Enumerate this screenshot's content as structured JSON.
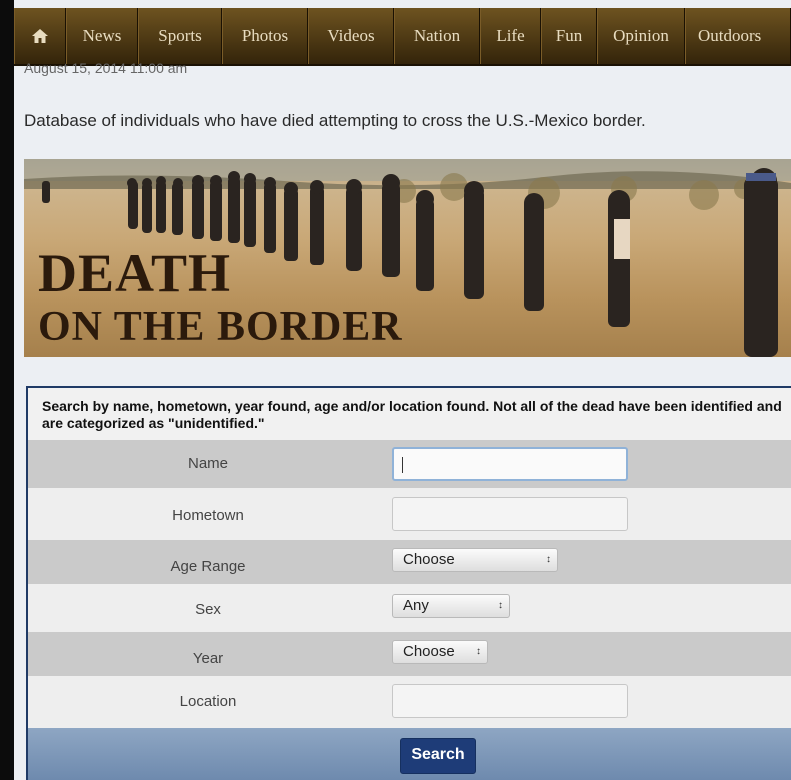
{
  "nav": {
    "home_icon": "home-icon",
    "items": [
      "News",
      "Sports",
      "Photos",
      "Videos",
      "Nation",
      "Life",
      "Fun",
      "Opinion",
      "Outdoors"
    ]
  },
  "article": {
    "dateline": "August 15, 2014 11:00 am",
    "intro": "Database of individuals who have died attempting to cross the U.S.-Mexico border."
  },
  "banner": {
    "title_line1": "DEATH",
    "title_line2": "ON THE BORDER"
  },
  "form": {
    "instructions": "Search by name, hometown, year found, age and/or location found. Not all of the dead have been identified and are categorized as \"unidentified.\"",
    "name_label": "Name",
    "name_value": "",
    "hometown_label": "Hometown",
    "hometown_value": "",
    "age_label": "Age Range",
    "age_value": "Choose",
    "sex_label": "Sex",
    "sex_value": "Any",
    "year_label": "Year",
    "year_value": "Choose",
    "location_label": "Location",
    "location_value": "",
    "search_label": "Search"
  },
  "colors": {
    "nav_bg": "#4a3512",
    "form_border": "#1f3a66",
    "button_bg": "#1e3c78"
  }
}
